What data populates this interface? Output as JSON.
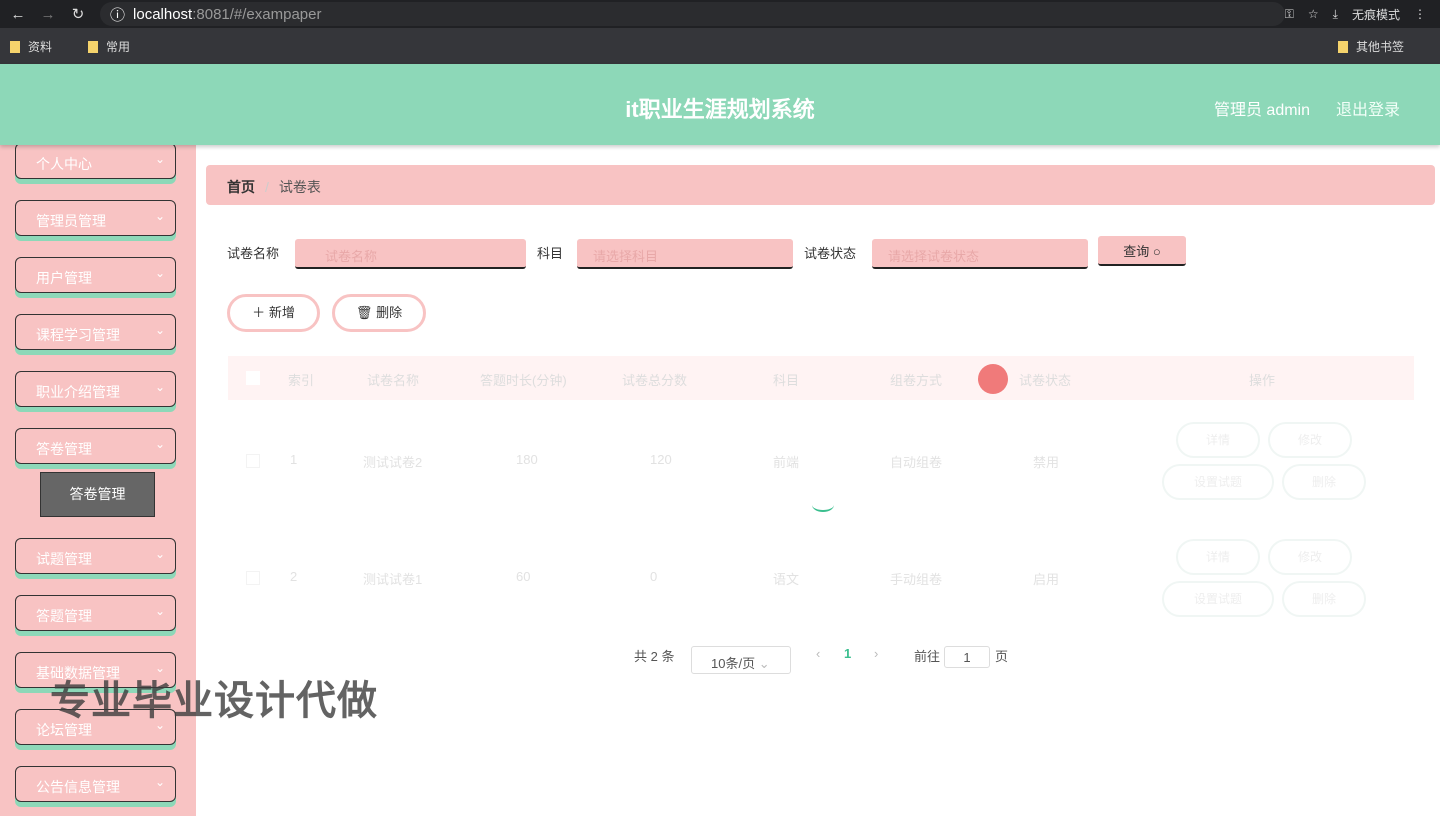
{
  "browser": {
    "url_host": "localhost",
    "url_rest": ":8081/#/exampaper",
    "incognito": "无痕模式",
    "bookmarks": [
      "资料",
      "常用"
    ],
    "other_bookmarks": "其他书签"
  },
  "header": {
    "title": "it职业生涯规划系统",
    "user": "管理员 admin",
    "logout": "退出登录"
  },
  "sidebar": {
    "items": [
      "个人中心",
      "管理员管理",
      "用户管理",
      "课程学习管理",
      "职业介绍管理",
      "答卷管理",
      "试题管理",
      "答题管理",
      "基础数据管理",
      "论坛管理",
      "公告信息管理"
    ],
    "sub_item": "答卷管理"
  },
  "breadcrumb": {
    "home": "首页",
    "current": "试卷表"
  },
  "search": {
    "name_label": "试卷名称",
    "name_placeholder": "试卷名称",
    "subject_label": "科目",
    "subject_placeholder": "请选择科目",
    "status_label": "试卷状态",
    "status_placeholder": "请选择试卷状态",
    "query": "查询"
  },
  "actions": {
    "add": "新增",
    "delete": "删除"
  },
  "table": {
    "headers": [
      "索引",
      "试卷名称",
      "答题时长(分钟)",
      "试卷总分数",
      "科目",
      "组卷方式",
      "试卷状态",
      "操作"
    ],
    "rows": [
      {
        "index": "1",
        "name": "测试试卷2",
        "duration": "180",
        "score": "120",
        "subject": "前端",
        "mode": "自动组卷",
        "status": "禁用",
        "ops": [
          "详情",
          "修改",
          "设置试题",
          "删除"
        ]
      },
      {
        "index": "2",
        "name": "测试试卷1",
        "duration": "60",
        "score": "0",
        "subject": "语文",
        "mode": "手动组卷",
        "status": "启用",
        "ops": [
          "详情",
          "修改",
          "设置试题",
          "删除"
        ]
      }
    ]
  },
  "pagination": {
    "total": "共 2 条",
    "page_size": "10条/页",
    "current": "1",
    "goto": "前往",
    "goto_value": "1",
    "page_suffix": "页"
  },
  "watermark": "专业毕业设计代做"
}
